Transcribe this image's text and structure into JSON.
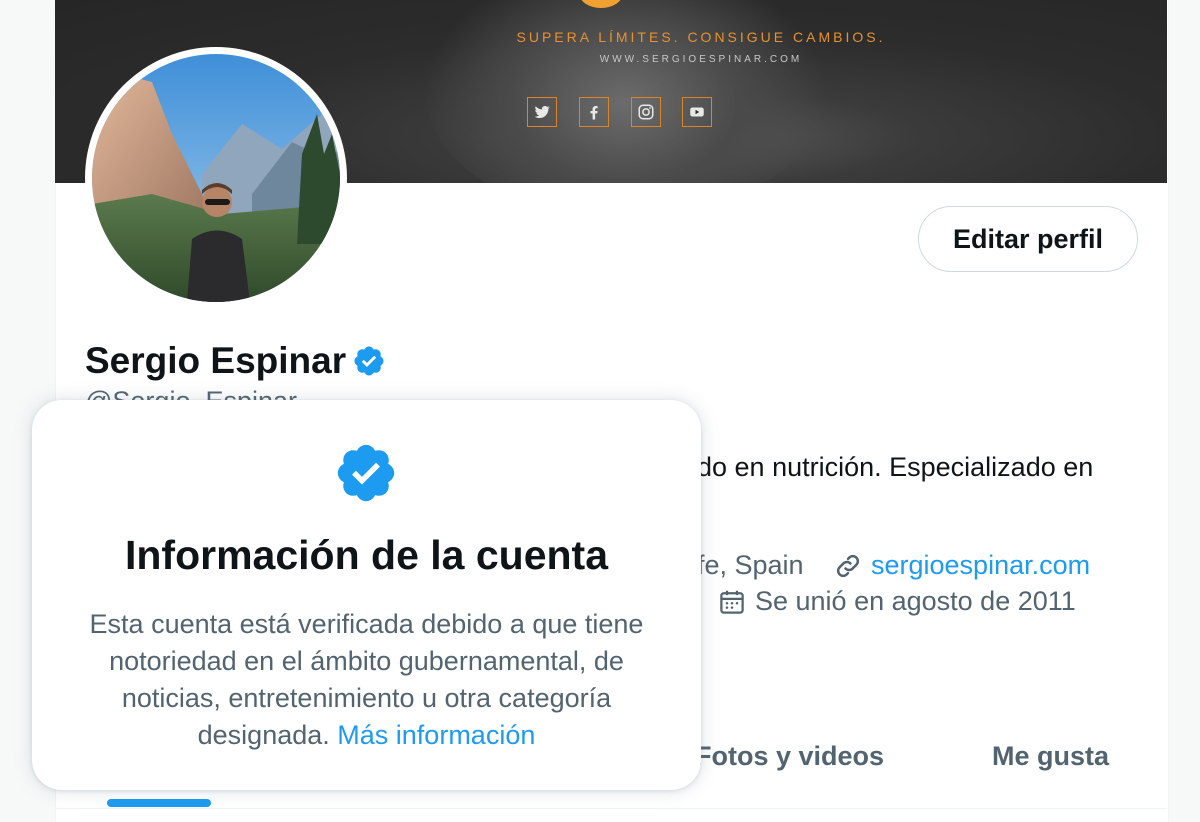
{
  "banner": {
    "slogan": "SUPERA LÍMITES. CONSIGUE CAMBIOS.",
    "website": "WWW.SERGIOESPINAR.COM",
    "social_icons": [
      "twitter-icon",
      "facebook-icon",
      "instagram-icon",
      "youtube-icon"
    ],
    "accent_color": "#e8912e"
  },
  "profile": {
    "edit_button_label": "Editar perfil",
    "display_name": "Sergio Espinar",
    "handle": "@Sergio_Espinar",
    "bio_visible": "do en nutrición. Especializado en",
    "location_visible": "fe, Spain",
    "website": "sergioespinar.com",
    "joined": "Se unió en agosto de 2011"
  },
  "tabs": {
    "photos_videos": "Fotos y videos",
    "likes": "Me gusta",
    "active_color": "#1d9bf0"
  },
  "popover": {
    "title": "Información de la cuenta",
    "body": "Esta cuenta está verificada debido a que tiene notoriedad en el ámbito gubernamental, de noticias, entretenimiento u otra categoría designada.",
    "link": "Más información"
  },
  "colors": {
    "verified_blue": "#1d9bf0",
    "text_primary": "#0f1419",
    "text_secondary": "#536471"
  }
}
